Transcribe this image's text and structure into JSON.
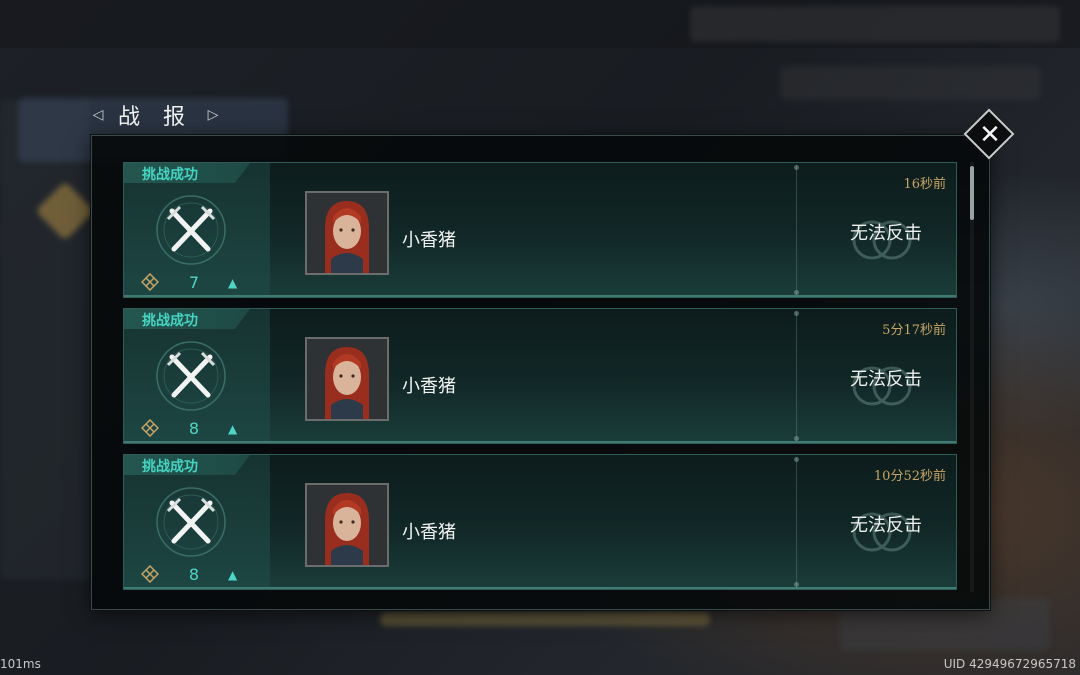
{
  "header": {
    "title": "战 报",
    "left_arrow_icon": "chevron-left-icon",
    "right_arrow_icon": "chevron-right-icon"
  },
  "dialog": {
    "close_icon": "close-icon"
  },
  "reports": [
    {
      "result": "挑战成功",
      "rank_value": "7",
      "rank_trend": "▲",
      "player_name": "小香猪",
      "time_ago": "16秒前",
      "action": "无法反击"
    },
    {
      "result": "挑战成功",
      "rank_value": "8",
      "rank_trend": "▲",
      "player_name": "小香猪",
      "time_ago": "5分17秒前",
      "action": "无法反击"
    },
    {
      "result": "挑战成功",
      "rank_value": "8",
      "rank_trend": "▲",
      "player_name": "小香猪",
      "time_ago": "10分52秒前",
      "action": "无法反击"
    }
  ],
  "footer": {
    "latency": "101ms",
    "uid": "UID 42949672965718"
  },
  "colors": {
    "accent": "#46d4c2",
    "time": "#c7a566",
    "card_bg": "#112827"
  }
}
